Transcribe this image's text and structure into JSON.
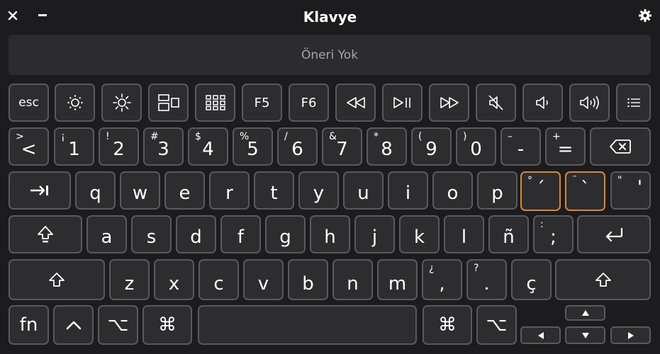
{
  "window": {
    "title": "Klavye"
  },
  "suggestions": {
    "text": "Öneri Yok"
  },
  "rows": {
    "fkeys": [
      {
        "name": "esc-key",
        "label": "esc"
      },
      {
        "name": "brightness-down-key",
        "icon": "sun-small-icon"
      },
      {
        "name": "brightness-up-key",
        "icon": "sun-large-icon"
      },
      {
        "name": "mission-control-key",
        "icon": "mission-control-icon"
      },
      {
        "name": "launchpad-key",
        "icon": "launchpad-grid-icon"
      },
      {
        "name": "f5-key",
        "label": "F5"
      },
      {
        "name": "f6-key",
        "label": "F6"
      },
      {
        "name": "rewind-key",
        "icon": "rewind-icon"
      },
      {
        "name": "play-pause-key",
        "icon": "play-pause-icon"
      },
      {
        "name": "fast-forward-key",
        "icon": "fast-forward-icon"
      },
      {
        "name": "mute-key",
        "icon": "speaker-mute-icon"
      },
      {
        "name": "volume-down-key",
        "icon": "speaker-low-icon"
      },
      {
        "name": "volume-up-key",
        "icon": "speaker-high-icon"
      },
      {
        "name": "more-key",
        "icon": "list-icon"
      }
    ],
    "number": [
      {
        "main": "<",
        "sec": ">"
      },
      {
        "main": "1",
        "sec": "¡"
      },
      {
        "main": "2",
        "sec": "!"
      },
      {
        "main": "3",
        "sec": "#"
      },
      {
        "main": "4",
        "sec": "$"
      },
      {
        "main": "5",
        "sec": "%"
      },
      {
        "main": "6",
        "sec": "/"
      },
      {
        "main": "7",
        "sec": "&"
      },
      {
        "main": "8",
        "sec": "*"
      },
      {
        "main": "9",
        "sec": "("
      },
      {
        "main": "0",
        "sec": ")"
      },
      {
        "main": "-",
        "sec": "–"
      },
      {
        "main": "=",
        "sec": "+"
      }
    ],
    "qwerty": [
      "q",
      "w",
      "e",
      "r",
      "t",
      "y",
      "u",
      "i",
      "o",
      "p"
    ],
    "qwerty_extra": [
      {
        "main": "´",
        "sec": "°"
      },
      {
        "main": "`",
        "sec": "¨"
      },
      {
        "main": "'",
        "sec": "\""
      }
    ],
    "home": [
      "a",
      "s",
      "d",
      "f",
      "g",
      "h",
      "j",
      "k",
      "l",
      "ñ"
    ],
    "home_extra": {
      "main": ";",
      "sec": ":"
    },
    "bottom": [
      "z",
      "x",
      "c",
      "v",
      "b",
      "n",
      "m"
    ],
    "bottom_extra": [
      {
        "main": ",",
        "sec": "¿"
      },
      {
        "main": ".",
        "sec": "?"
      },
      {
        "main": "ç",
        "sec": ""
      }
    ],
    "modifiers": {
      "fn": "fn",
      "control": "^",
      "option": "⌥",
      "command": "⌘"
    }
  },
  "colors": {
    "background": "#1c1c1e",
    "key": "#2d2d30",
    "key_border": "#5a5a5e",
    "highlight": "#d9863c"
  }
}
